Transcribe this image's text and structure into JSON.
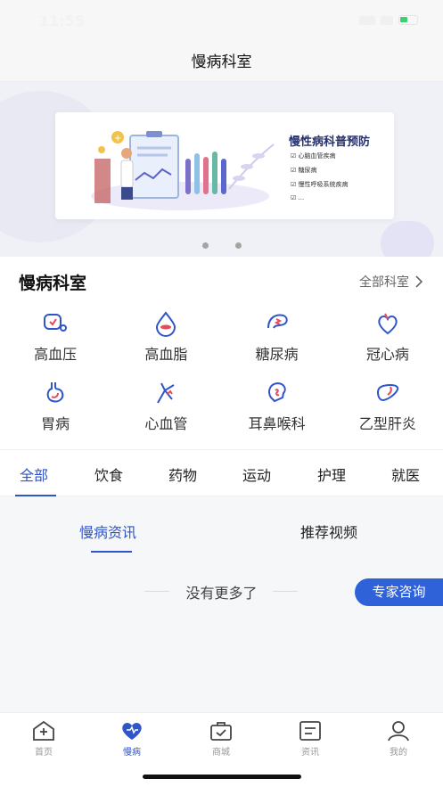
{
  "status": {
    "time": "11:55"
  },
  "nav": {
    "title": "慢病科室"
  },
  "banner": {
    "title": "慢性病科普预防",
    "items": [
      "心脑血管疾病",
      "糖尿病",
      "慢性呼吸系统疾病",
      "..."
    ],
    "page_count": 2,
    "active_page": 1
  },
  "department": {
    "heading": "慢病科室",
    "all_label": "全部科室",
    "items": [
      {
        "label": "高血压",
        "icon": "stethoscope-heart-icon"
      },
      {
        "label": "高血脂",
        "icon": "blood-drop-icon"
      },
      {
        "label": "糖尿病",
        "icon": "pancreas-icon"
      },
      {
        "label": "冠心病",
        "icon": "heart-icon"
      },
      {
        "label": "胃病",
        "icon": "stomach-icon"
      },
      {
        "label": "心血管",
        "icon": "blood-vessel-icon"
      },
      {
        "label": "耳鼻喉科",
        "icon": "ear-nose-throat-icon"
      },
      {
        "label": "乙型肝炎",
        "icon": "liver-icon"
      }
    ]
  },
  "category_tabs": [
    "全部",
    "饮食",
    "药物",
    "运动",
    "护理",
    "就医"
  ],
  "sub_tabs": [
    "慢病资讯",
    "推荐视频"
  ],
  "empty": {
    "text": "没有更多了"
  },
  "consult_button": "专家咨询",
  "tabbar": [
    {
      "label": "首页",
      "icon": "home-icon"
    },
    {
      "label": "慢病",
      "icon": "heart-icon"
    },
    {
      "label": "商城",
      "icon": "shopping-bag-icon"
    },
    {
      "label": "资讯",
      "icon": "news-icon"
    },
    {
      "label": "我的",
      "icon": "user-icon"
    }
  ],
  "colors": {
    "accent": "#2f55c8",
    "consult": "#2f61d9"
  }
}
